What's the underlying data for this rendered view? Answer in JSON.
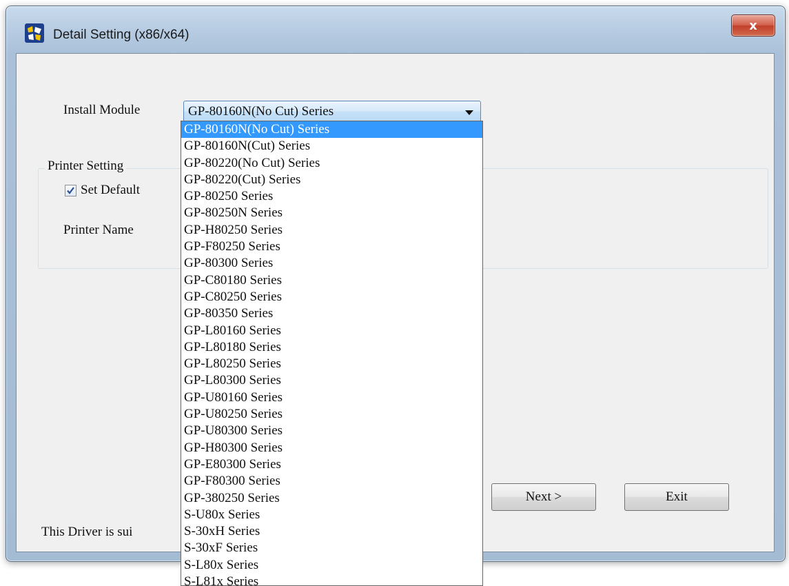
{
  "window": {
    "title": "Detail Setting (x86/x64)",
    "close_label": "x"
  },
  "install_module": {
    "label": "Install Module",
    "selected": "GP-80160N(No Cut) Series"
  },
  "printer_setting": {
    "title": "Printer Setting",
    "set_default_label": "Set Default",
    "set_default_checked": true,
    "printer_name_label": "Printer Name"
  },
  "buttons": {
    "next": "Next >",
    "exit": "Exit"
  },
  "footer": {
    "text": "This Driver is sui"
  },
  "dropdown": {
    "selected_index": 0,
    "options": [
      "GP-80160N(No Cut) Series",
      "GP-80160N(Cut) Series",
      "GP-80220(No Cut) Series",
      "GP-80220(Cut) Series",
      "GP-80250 Series",
      "GP-80250N Series",
      "GP-H80250 Series",
      "GP-F80250 Series",
      "GP-80300 Series",
      "GP-C80180 Series",
      "GP-C80250 Series",
      "GP-80350 Series",
      "GP-L80160 Series",
      "GP-L80180 Series",
      "GP-L80250 Series",
      "GP-L80300 Series",
      "GP-U80160 Series",
      "GP-U80250 Series",
      "GP-U80300 Series",
      "GP-H80300 Series",
      "GP-E80300 Series",
      "GP-F80300 Series",
      "GP-380250 Series",
      "S-U80x Series",
      "S-30xH Series",
      "S-30xF Series",
      "S-L80x Series",
      "S-L81x Series"
    ]
  },
  "colors": {
    "selection": "#3399ff",
    "close_button": "#c2402a",
    "dialog_background": "#f0f0f0"
  },
  "icons": {
    "app": "printer-driver-app-icon",
    "close": "close-icon",
    "dropdown": "chevron-down-icon",
    "checkbox": "checkmark-icon"
  }
}
